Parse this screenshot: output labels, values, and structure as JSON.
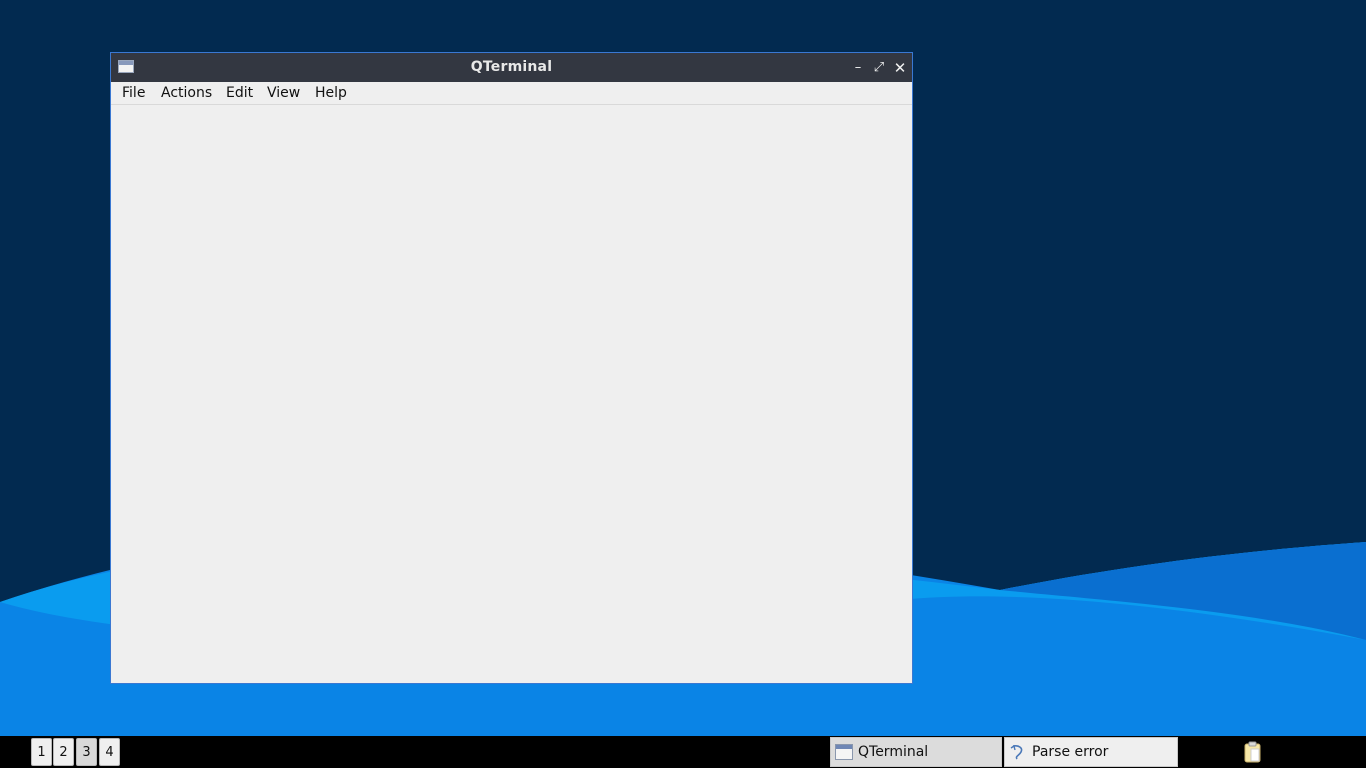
{
  "window": {
    "title": "QTerminal",
    "icon": "terminal-window-icon",
    "controls": {
      "minimize": "–",
      "maximize": "⤢",
      "close": "✕"
    }
  },
  "menu": {
    "file": "File",
    "actions": "Actions",
    "edit": "Edit",
    "view": "View",
    "help": "Help"
  },
  "taskbar": {
    "workspaces": [
      "1",
      "2",
      "3",
      "4"
    ],
    "active_workspace": "3",
    "tasks": [
      {
        "label": "QTerminal",
        "icon": "terminal-window-icon"
      },
      {
        "label": "Parse error",
        "icon": "parse-error-icon"
      }
    ],
    "tray_icon": "clipboard-icon"
  },
  "colors": {
    "desktop_dark": "#022a50",
    "wave_light": "#0aa0f0",
    "wave_mid": "#0a84e6",
    "titlebar": "#333741",
    "window_bg": "#efefef",
    "window_border": "#3a78d2",
    "taskbar": "#000000"
  }
}
